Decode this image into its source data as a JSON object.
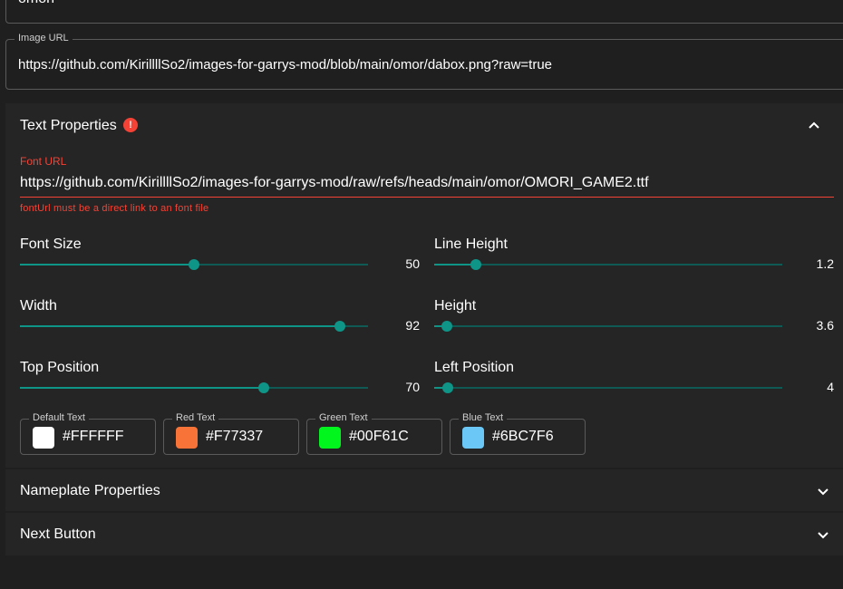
{
  "top_field": {
    "value": "omori"
  },
  "image_url": {
    "label": "Image URL",
    "value": "https://github.com/KirillllSo2/images-for-garrys-mod/blob/main/omor/dabox.png?raw=true"
  },
  "text_properties": {
    "title": "Text Properties",
    "error_icon": "exclamation-circle-icon",
    "font_url": {
      "label": "Font URL",
      "value": "https://github.com/KirillllSo2/images-for-garrys-mod/raw/refs/heads/main/omor/OMORI_GAME2.ttf",
      "helper": "fontUrl must be a direct link to an font file"
    },
    "sliders": [
      {
        "label": "Font Size",
        "value": "50",
        "fraction": 0.5
      },
      {
        "label": "Line Height",
        "value": "1.2",
        "fraction": 0.12
      },
      {
        "label": "Width",
        "value": "92",
        "fraction": 0.92
      },
      {
        "label": "Height",
        "value": "3.6",
        "fraction": 0.036
      },
      {
        "label": "Top Position",
        "value": "70",
        "fraction": 0.7
      },
      {
        "label": "Left Position",
        "value": "4",
        "fraction": 0.04
      }
    ],
    "colors": [
      {
        "label": "Default Text",
        "hex": "#FFFFFF",
        "swatch": "#FFFFFF"
      },
      {
        "label": "Red Text",
        "hex": "#F77337",
        "swatch": "#F77337"
      },
      {
        "label": "Green Text",
        "hex": "#00F61C",
        "swatch": "#00F61C"
      },
      {
        "label": "Blue Text",
        "hex": "#6BC7F6",
        "swatch": "#6BC7F6"
      }
    ]
  },
  "nameplate": {
    "title": "Nameplate Properties"
  },
  "next_button": {
    "title": "Next Button"
  },
  "theme": {
    "accent": "#0f9488",
    "error": "#f44336"
  }
}
